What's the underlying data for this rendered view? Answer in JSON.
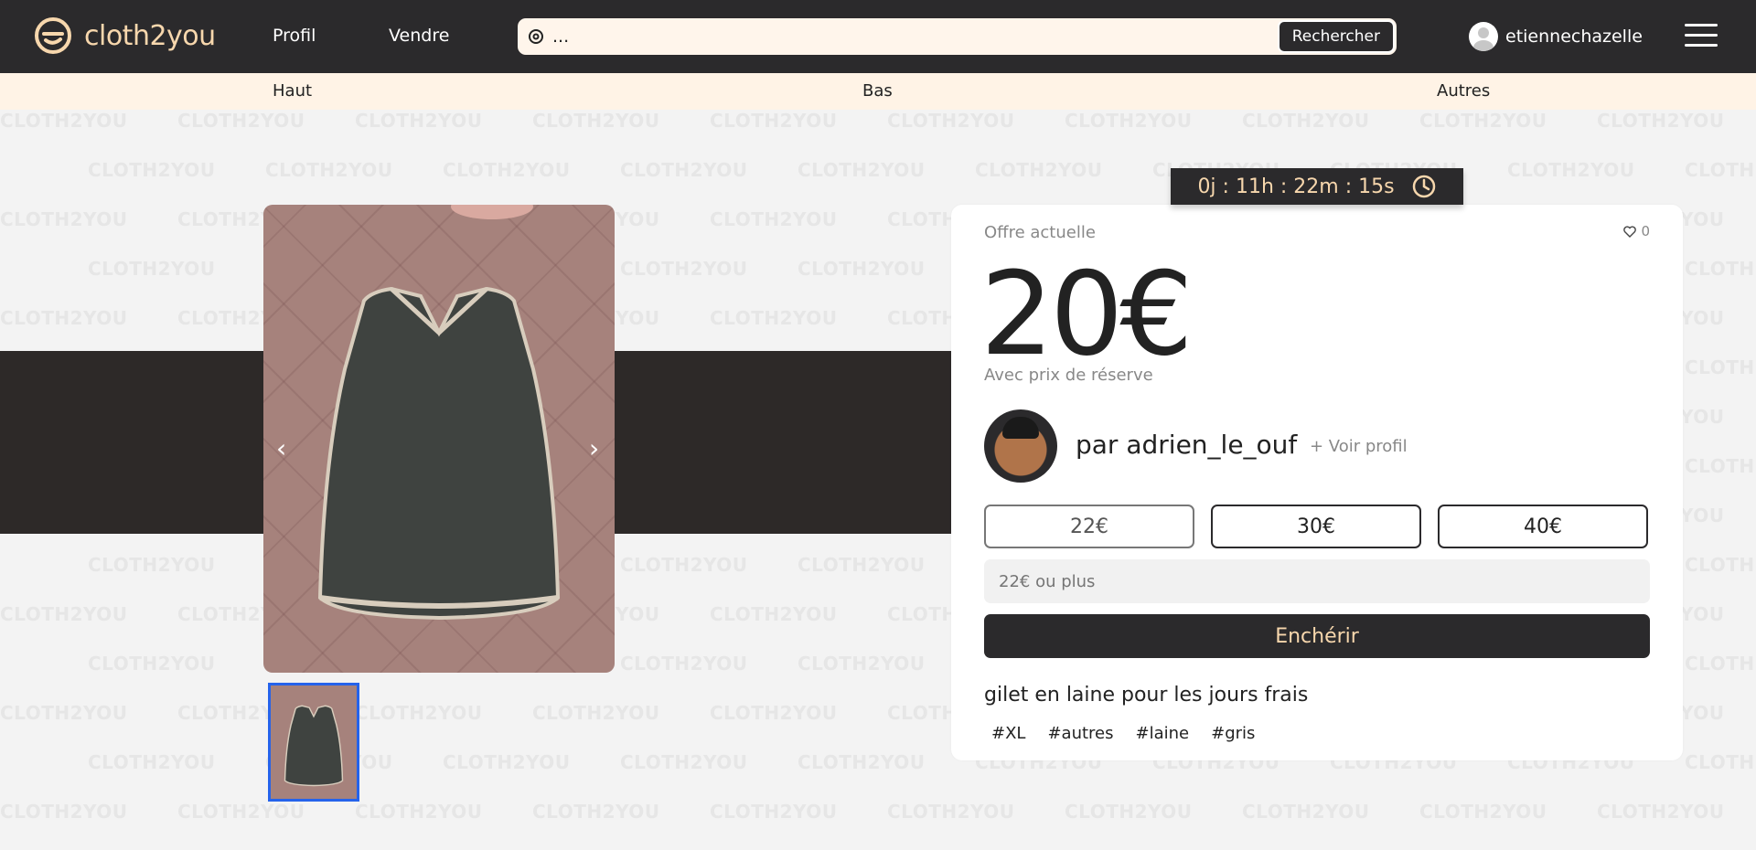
{
  "brand": {
    "name": "cloth2you",
    "accent": "#f7d7ad",
    "dark": "#2b2a2c",
    "cream": "#fff3e6"
  },
  "nav": {
    "profil": "Profil",
    "vendre": "Vendre"
  },
  "search": {
    "value": "...",
    "button": "Rechercher",
    "icon": "search-icon"
  },
  "user": {
    "name": "etiennechazelle"
  },
  "categories": [
    "Haut",
    "Bas",
    "Autres"
  ],
  "watermark": "CLOTH2YOU",
  "gallery": {
    "prev": "‹",
    "next": "›"
  },
  "timer": {
    "text": "0j : 11h : 22m : 15s",
    "icon": "clock-icon"
  },
  "auction": {
    "offer_label": "Offre actuelle",
    "likes": "0",
    "price": "20€",
    "reserve": "Avec prix de réserve",
    "seller": "par adrien_le_ouf",
    "view_profile": "+ Voir profil",
    "quick_bids": [
      "22€",
      "30€",
      "40€"
    ],
    "bid_placeholder": "22€ ou plus",
    "submit": "Enchérir",
    "description": "gilet en laine pour les jours frais",
    "tags": [
      "#XL",
      "#autres",
      "#laine",
      "#gris"
    ]
  }
}
